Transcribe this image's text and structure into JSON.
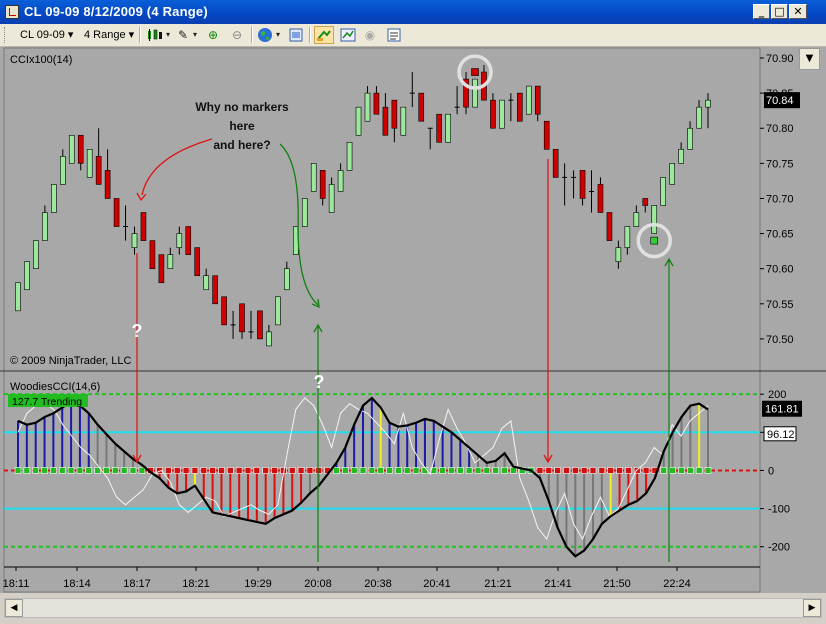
{
  "window": {
    "title": "CL 09-09  8/12/2009 (4 Range)",
    "minimize": "_",
    "maximize": "□",
    "close": "✕"
  },
  "toolbar": {
    "instrument": "CL 09-09",
    "instrument_caret": "▾",
    "period": "4 Range",
    "period_caret": "▾",
    "icons": [
      "candlestick-icon",
      "pencil-icon",
      "zoom-in-icon",
      "zoom-out-icon",
      "globe-icon",
      "properties-icon",
      "hand-tool-icon",
      "chart-trader-icon",
      "disc-icon",
      "data-box-icon"
    ]
  },
  "chart_data": [
    {
      "type": "candlestick",
      "title": "CCIx100(14)",
      "copyright": "© 2009 NinjaTrader, LLC",
      "current_price": "70.84",
      "ylim": [
        70.46,
        70.91
      ],
      "yticks": [
        "70.50",
        "70.55",
        "70.60",
        "70.65",
        "70.70",
        "70.75",
        "70.80",
        "70.85",
        "70.90"
      ],
      "candles": [
        {
          "o": 70.54,
          "c": 70.58,
          "h": 70.58,
          "l": 70.54
        },
        {
          "o": 70.57,
          "c": 70.61,
          "h": 70.61,
          "l": 70.57
        },
        {
          "o": 70.6,
          "c": 70.64,
          "h": 70.64,
          "l": 70.6
        },
        {
          "o": 70.64,
          "c": 70.68,
          "h": 70.69,
          "l": 70.64
        },
        {
          "o": 70.68,
          "c": 70.72,
          "h": 70.72,
          "l": 70.68
        },
        {
          "o": 70.72,
          "c": 70.76,
          "h": 70.77,
          "l": 70.72
        },
        {
          "o": 70.75,
          "c": 70.79,
          "h": 70.79,
          "l": 70.75
        },
        {
          "o": 70.79,
          "c": 70.75,
          "h": 70.79,
          "l": 70.74
        },
        {
          "o": 70.73,
          "c": 70.77,
          "h": 70.77,
          "l": 70.73
        },
        {
          "o": 70.76,
          "c": 70.72,
          "h": 70.8,
          "l": 70.72
        },
        {
          "o": 70.74,
          "c": 70.7,
          "h": 70.77,
          "l": 70.7
        },
        {
          "o": 70.7,
          "c": 70.66,
          "h": 70.7,
          "l": 70.66
        },
        {
          "o": 70.66,
          "c": 70.66,
          "h": 70.69,
          "l": 70.64
        },
        {
          "o": 70.63,
          "c": 70.65,
          "h": 70.66,
          "l": 70.62
        },
        {
          "o": 70.68,
          "c": 70.64,
          "h": 70.68,
          "l": 70.64
        },
        {
          "o": 70.64,
          "c": 70.6,
          "h": 70.64,
          "l": 70.6
        },
        {
          "o": 70.62,
          "c": 70.58,
          "h": 70.62,
          "l": 70.58
        },
        {
          "o": 70.6,
          "c": 70.62,
          "h": 70.63,
          "l": 70.6
        },
        {
          "o": 70.63,
          "c": 70.65,
          "h": 70.66,
          "l": 70.62
        },
        {
          "o": 70.66,
          "c": 70.62,
          "h": 70.66,
          "l": 70.62
        },
        {
          "o": 70.63,
          "c": 70.59,
          "h": 70.63,
          "l": 70.59
        },
        {
          "o": 70.57,
          "c": 70.59,
          "h": 70.6,
          "l": 70.57
        },
        {
          "o": 70.59,
          "c": 70.55,
          "h": 70.59,
          "l": 70.55
        },
        {
          "o": 70.56,
          "c": 70.52,
          "h": 70.56,
          "l": 70.52
        },
        {
          "o": 70.52,
          "c": 70.52,
          "h": 70.54,
          "l": 70.5
        },
        {
          "o": 70.55,
          "c": 70.51,
          "h": 70.55,
          "l": 70.5
        },
        {
          "o": 70.51,
          "c": 70.51,
          "h": 70.54,
          "l": 70.5
        },
        {
          "o": 70.54,
          "c": 70.5,
          "h": 70.54,
          "l": 70.5
        },
        {
          "o": 70.49,
          "c": 70.51,
          "h": 70.52,
          "l": 70.49
        },
        {
          "o": 70.52,
          "c": 70.56,
          "h": 70.56,
          "l": 70.52
        },
        {
          "o": 70.57,
          "c": 70.6,
          "h": 70.61,
          "l": 70.57
        },
        {
          "o": 70.62,
          "c": 70.66,
          "h": 70.66,
          "l": 70.62
        },
        {
          "o": 70.66,
          "c": 70.7,
          "h": 70.7,
          "l": 70.66
        },
        {
          "o": 70.71,
          "c": 70.75,
          "h": 70.75,
          "l": 70.71
        },
        {
          "o": 70.74,
          "c": 70.7,
          "h": 70.74,
          "l": 70.69
        },
        {
          "o": 70.68,
          "c": 70.72,
          "h": 70.73,
          "l": 70.68
        },
        {
          "o": 70.71,
          "c": 70.74,
          "h": 70.75,
          "l": 70.71
        },
        {
          "o": 70.74,
          "c": 70.78,
          "h": 70.78,
          "l": 70.74
        },
        {
          "o": 70.79,
          "c": 70.83,
          "h": 70.83,
          "l": 70.79
        },
        {
          "o": 70.81,
          "c": 70.85,
          "h": 70.86,
          "l": 70.81
        },
        {
          "o": 70.85,
          "c": 70.82,
          "h": 70.86,
          "l": 70.82
        },
        {
          "o": 70.83,
          "c": 70.79,
          "h": 70.85,
          "l": 70.79
        },
        {
          "o": 70.84,
          "c": 70.8,
          "h": 70.84,
          "l": 70.78
        },
        {
          "o": 70.79,
          "c": 70.83,
          "h": 70.83,
          "l": 70.79
        },
        {
          "o": 70.85,
          "c": 70.85,
          "h": 70.88,
          "l": 70.83
        },
        {
          "o": 70.85,
          "c": 70.81,
          "h": 70.85,
          "l": 70.81
        },
        {
          "o": 70.8,
          "c": 70.8,
          "h": 70.8,
          "l": 70.77
        },
        {
          "o": 70.82,
          "c": 70.78,
          "h": 70.82,
          "l": 70.78
        },
        {
          "o": 70.78,
          "c": 70.82,
          "h": 70.82,
          "l": 70.78
        },
        {
          "o": 70.83,
          "c": 70.83,
          "h": 70.86,
          "l": 70.82
        },
        {
          "o": 70.87,
          "c": 70.83,
          "h": 70.88,
          "l": 70.82
        },
        {
          "o": 70.83,
          "c": 70.87,
          "h": 70.87,
          "l": 70.83
        },
        {
          "o": 70.88,
          "c": 70.84,
          "h": 70.89,
          "l": 70.84
        },
        {
          "o": 70.84,
          "c": 70.8,
          "h": 70.85,
          "l": 70.8
        },
        {
          "o": 70.8,
          "c": 70.84,
          "h": 70.84,
          "l": 70.8
        },
        {
          "o": 70.84,
          "c": 70.84,
          "h": 70.85,
          "l": 70.81
        },
        {
          "o": 70.85,
          "c": 70.81,
          "h": 70.85,
          "l": 70.81
        },
        {
          "o": 70.82,
          "c": 70.86,
          "h": 70.86,
          "l": 70.82
        },
        {
          "o": 70.86,
          "c": 70.82,
          "h": 70.86,
          "l": 70.81
        },
        {
          "o": 70.81,
          "c": 70.77,
          "h": 70.81,
          "l": 70.77
        },
        {
          "o": 70.77,
          "c": 70.73,
          "h": 70.77,
          "l": 70.73
        },
        {
          "o": 70.73,
          "c": 70.73,
          "h": 70.75,
          "l": 70.69
        },
        {
          "o": 70.73,
          "c": 70.73,
          "h": 70.74,
          "l": 70.7
        },
        {
          "o": 70.74,
          "c": 70.7,
          "h": 70.74,
          "l": 70.69
        },
        {
          "o": 70.71,
          "c": 70.71,
          "h": 70.74,
          "l": 70.68
        },
        {
          "o": 70.72,
          "c": 70.68,
          "h": 70.73,
          "l": 70.68
        },
        {
          "o": 70.68,
          "c": 70.64,
          "h": 70.68,
          "l": 70.64
        },
        {
          "o": 70.61,
          "c": 70.63,
          "h": 70.64,
          "l": 70.6
        },
        {
          "o": 70.63,
          "c": 70.66,
          "h": 70.66,
          "l": 70.62
        },
        {
          "o": 70.66,
          "c": 70.68,
          "h": 70.69,
          "l": 70.66
        },
        {
          "o": 70.7,
          "c": 70.69,
          "h": 70.7,
          "l": 70.68
        },
        {
          "o": 70.65,
          "c": 70.69,
          "h": 70.69,
          "l": 70.65
        },
        {
          "o": 70.69,
          "c": 70.73,
          "h": 70.73,
          "l": 70.69
        },
        {
          "o": 70.72,
          "c": 70.75,
          "h": 70.75,
          "l": 70.72
        },
        {
          "o": 70.75,
          "c": 70.77,
          "h": 70.78,
          "l": 70.75
        },
        {
          "o": 70.77,
          "c": 70.8,
          "h": 70.81,
          "l": 70.77
        },
        {
          "o": 70.8,
          "c": 70.83,
          "h": 70.84,
          "l": 70.8
        },
        {
          "o": 70.83,
          "c": 70.84,
          "h": 70.85,
          "l": 70.8
        }
      ],
      "markers": [
        {
          "index": 51,
          "price": 70.88,
          "color": "#cc0000"
        },
        {
          "index": 71,
          "price": 70.64,
          "color": "#33cc33"
        }
      ],
      "annotations": {
        "line1": "Why no markers",
        "line2": "here",
        "line3": "and here?"
      }
    },
    {
      "type": "bar",
      "title": "WoodiesCCI(14,6)",
      "badge": "127.7 Trending",
      "badge_color": "#22bb22",
      "last_value": "161.81",
      "last_value2": "96.12",
      "ylim": [
        -240,
        245
      ],
      "yticks": [
        "200",
        "100",
        "0",
        "-100",
        "-200"
      ],
      "levels": [
        200,
        100,
        0,
        -100,
        -200
      ],
      "cci": [
        130,
        120,
        125,
        140,
        150,
        165,
        180,
        170,
        150,
        120,
        95,
        70,
        50,
        30,
        15,
        -5,
        -20,
        -45,
        -60,
        -55,
        -40,
        -75,
        -110,
        -115,
        -120,
        -125,
        -130,
        -135,
        -140,
        -125,
        -115,
        -105,
        -85,
        -60,
        -40,
        -10,
        20,
        60,
        120,
        170,
        190,
        165,
        125,
        115,
        118,
        125,
        135,
        130,
        115,
        100,
        80,
        60,
        40,
        20,
        25,
        45,
        10,
        5,
        0,
        -20,
        -80,
        -150,
        -200,
        -225,
        -210,
        -180,
        -140,
        -120,
        -105,
        -90,
        -80,
        -60,
        -20,
        50,
        100,
        140,
        170,
        175,
        160
      ],
      "turbo": [
        100,
        150,
        170,
        175,
        160,
        120,
        90,
        60,
        40,
        10,
        -20,
        -70,
        -90,
        -70,
        -50,
        -10,
        0,
        -30,
        -90,
        -110,
        -90,
        -70,
        -80,
        -120,
        -110,
        -100,
        -90,
        -105,
        -115,
        -90,
        40,
        160,
        190,
        170,
        120,
        60,
        150,
        175,
        160,
        150,
        125,
        100,
        70,
        150,
        60,
        20,
        -10,
        80,
        160,
        110,
        70,
        20,
        40,
        60,
        110,
        130,
        -20,
        -80,
        -150,
        -180,
        -110,
        -60,
        -140,
        -180,
        -120,
        -70,
        -120,
        -100,
        -50,
        0,
        20,
        60,
        40,
        120,
        90,
        130,
        150,
        170
      ],
      "histogram_colors": {
        "up": "#1a1aa8",
        "down": "#d81010",
        "neutral": "#777777",
        "trend_up": "#f0f020"
      }
    }
  ],
  "time_axis": [
    "18:11",
    "18:14",
    "18:17",
    "18:21",
    "19:29",
    "20:08",
    "20:38",
    "20:41",
    "21:21",
    "21:41",
    "21:50",
    "22:24"
  ],
  "question_marks": [
    "?",
    "?"
  ],
  "scroll": {
    "left": "◀",
    "right": "▶",
    "down": "▼"
  }
}
